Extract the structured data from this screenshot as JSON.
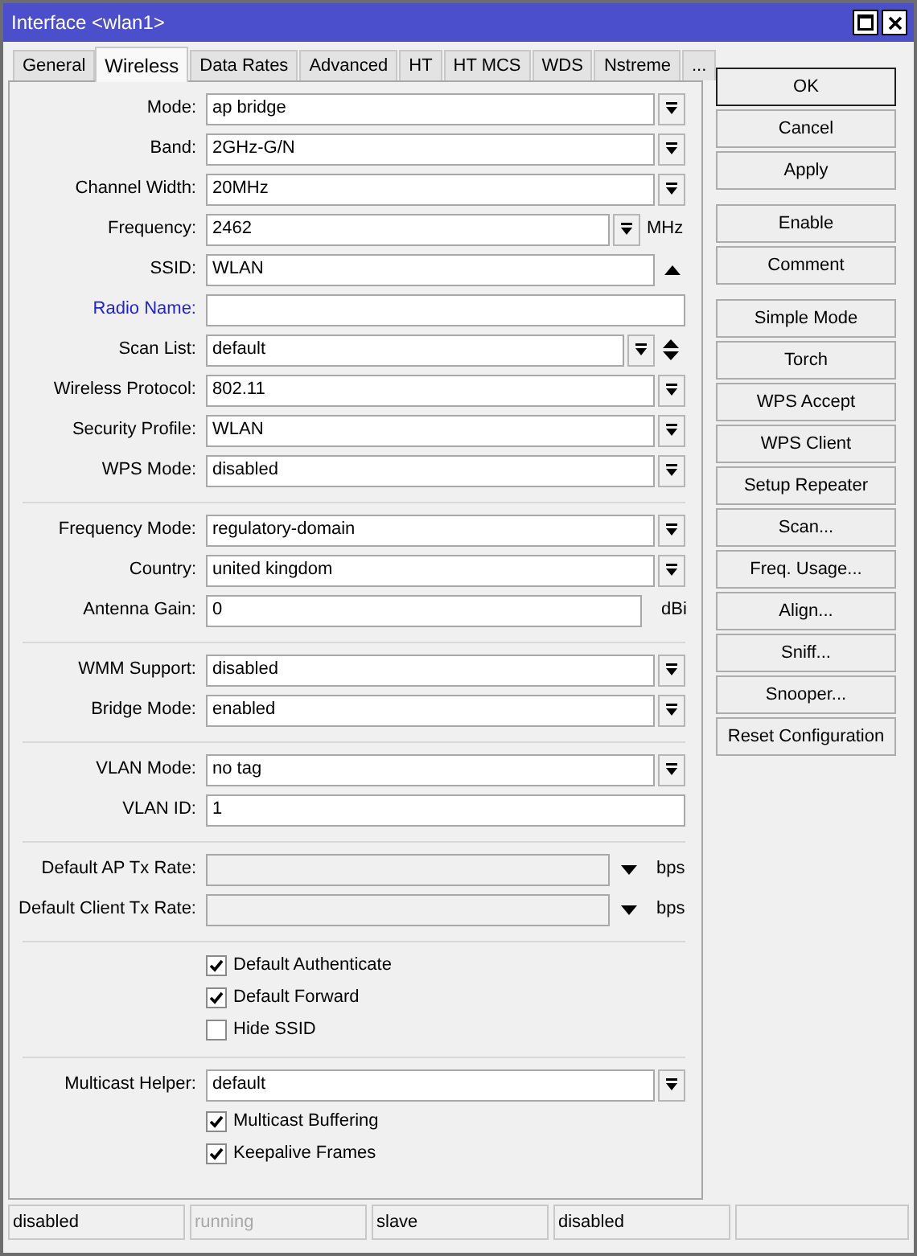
{
  "window": {
    "title": "Interface <wlan1>"
  },
  "tabs": [
    {
      "label": "General",
      "selected": false
    },
    {
      "label": "Wireless",
      "selected": true
    },
    {
      "label": "Data Rates",
      "selected": false
    },
    {
      "label": "Advanced",
      "selected": false
    },
    {
      "label": "HT",
      "selected": false
    },
    {
      "label": "HT MCS",
      "selected": false
    },
    {
      "label": "WDS",
      "selected": false
    },
    {
      "label": "Nstreme",
      "selected": false
    },
    {
      "label": "...",
      "selected": false
    }
  ],
  "form": {
    "sections": [
      {
        "rows": [
          {
            "kind": "select",
            "label": "Mode:",
            "value": "ap bridge",
            "emphasized": false
          },
          {
            "kind": "select",
            "label": "Band:",
            "value": "2GHz-G/N",
            "emphasized": false
          },
          {
            "kind": "select",
            "label": "Channel Width:",
            "value": "20MHz",
            "emphasized": false
          },
          {
            "kind": "select",
            "label": "Frequency:",
            "value": "2462",
            "suffix": "MHz",
            "emphasized": false
          },
          {
            "kind": "input-toggle",
            "label": "SSID:",
            "value": "WLAN",
            "emphasized": false
          },
          {
            "kind": "input",
            "label": "Radio Name:",
            "emphasized": true
          },
          {
            "kind": "select-updown",
            "label": "Scan List:",
            "value": "default",
            "emphasized": false
          },
          {
            "kind": "select",
            "label": "Wireless Protocol:",
            "value": "802.11",
            "emphasized": false
          },
          {
            "kind": "select",
            "label": "Security Profile:",
            "value": "WLAN",
            "emphasized": false
          },
          {
            "kind": "select",
            "label": "WPS Mode:",
            "value": "disabled",
            "emphasized": false
          }
        ]
      },
      {
        "rows": [
          {
            "kind": "select",
            "label": "Frequency Mode:",
            "value": "regulatory-domain",
            "emphasized": false
          },
          {
            "kind": "select",
            "label": "Country:",
            "value": "united kingdom",
            "emphasized": false
          },
          {
            "kind": "input",
            "label": "Antenna Gain:",
            "value": "0",
            "suffix": "dBi",
            "emphasized": false
          }
        ]
      },
      {
        "rows": [
          {
            "kind": "select",
            "label": "WMM Support:",
            "value": "disabled",
            "emphasized": false
          },
          {
            "kind": "select",
            "label": "Bridge Mode:",
            "value": "enabled",
            "emphasized": false
          }
        ]
      },
      {
        "rows": [
          {
            "kind": "select",
            "label": "VLAN Mode:",
            "value": "no tag",
            "emphasized": false
          },
          {
            "kind": "input",
            "label": "VLAN ID:",
            "value": "1",
            "emphasized": false
          }
        ]
      },
      {
        "rows": [
          {
            "kind": "rate",
            "label": "Default AP Tx Rate:",
            "suffix": "bps",
            "emphasized": false
          },
          {
            "kind": "rate",
            "label": "Default Client Tx Rate:",
            "suffix": "bps",
            "emphasized": false
          }
        ]
      },
      {
        "rows": [
          {
            "kind": "checkbox",
            "text": "Default Authenticate",
            "checked": true
          },
          {
            "kind": "checkbox",
            "text": "Default Forward",
            "checked": true
          },
          {
            "kind": "checkbox",
            "text": "Hide SSID",
            "checked": false
          }
        ]
      },
      {
        "rows": [
          {
            "kind": "select",
            "label": "Multicast Helper:",
            "value": "default",
            "emphasized": false
          },
          {
            "kind": "checkbox",
            "text": "Multicast Buffering",
            "checked": true
          },
          {
            "kind": "checkbox",
            "text": "Keepalive Frames",
            "checked": true
          }
        ]
      }
    ]
  },
  "button_groups": [
    [
      {
        "label": "OK",
        "default": true
      },
      {
        "label": "Cancel",
        "default": false
      },
      {
        "label": "Apply",
        "default": false
      }
    ],
    [
      {
        "label": "Enable",
        "default": false
      },
      {
        "label": "Comment",
        "default": false
      }
    ],
    [
      {
        "label": "Simple Mode",
        "default": false
      },
      {
        "label": "Torch",
        "default": false
      },
      {
        "label": "WPS Accept",
        "default": false
      },
      {
        "label": "WPS Client",
        "default": false
      },
      {
        "label": "Setup Repeater",
        "default": false
      },
      {
        "label": "Scan...",
        "default": false
      },
      {
        "label": "Freq. Usage...",
        "default": false
      },
      {
        "label": "Align...",
        "default": false
      },
      {
        "label": "Sniff...",
        "default": false
      },
      {
        "label": "Snooper...",
        "default": false
      },
      {
        "label": "Reset Configuration",
        "default": false
      }
    ]
  ],
  "status_bar": [
    {
      "text": "disabled",
      "dimmed": false
    },
    {
      "text": "running",
      "dimmed": true
    },
    {
      "text": "slave",
      "dimmed": false
    },
    {
      "text": "disabled",
      "dimmed": false
    }
  ]
}
